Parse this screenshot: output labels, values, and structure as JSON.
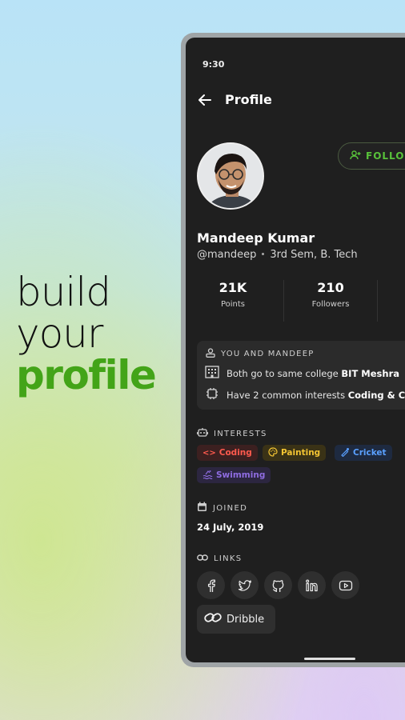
{
  "hero": {
    "line1": "build",
    "line2": "your",
    "line3": "profile"
  },
  "status_bar": {
    "time": "9:30"
  },
  "header": {
    "title": "Profile"
  },
  "follow_button": {
    "label": "FOLLOW"
  },
  "user": {
    "name": "Mandeep Kumar",
    "handle": "@mandeep",
    "sem": "3rd Sem, B. Tech"
  },
  "stats": [
    {
      "value": "21K",
      "label": "Points"
    },
    {
      "value": "210",
      "label": "Followers"
    }
  ],
  "mutual": {
    "title": "YOU AND MANDEEP",
    "college_prefix": "Both go to same college ",
    "college": "BIT Meshra",
    "interests_prefix": "Have 2 common interests ",
    "interests": "Coding & C"
  },
  "interests": {
    "title": "INTERESTS",
    "items": [
      {
        "label": "Coding",
        "color": "#ff5a4e",
        "bg": "#3c2020",
        "icon": "code-icon"
      },
      {
        "label": "Painting",
        "color": "#f3c433",
        "bg": "#3a3216",
        "icon": "palette-icon"
      },
      {
        "label": "Cricket",
        "color": "#5aa0ff",
        "bg": "#1e2a40",
        "icon": "cricket-icon"
      },
      {
        "label": "Swimming",
        "color": "#8e6ce0",
        "bg": "#2c2640",
        "icon": "swimming-icon"
      }
    ]
  },
  "joined": {
    "title": "JOINED",
    "date": "24 July, 2019"
  },
  "links": {
    "title": "LINKS",
    "items": [
      "facebook-icon",
      "twitter-icon",
      "github-icon",
      "linkedin-icon",
      "youtube-icon"
    ],
    "dribble_label": "Dribble"
  },
  "colors": {
    "accent": "#43a418",
    "follow": "#58c23a",
    "screen": "#1f1f1f"
  }
}
